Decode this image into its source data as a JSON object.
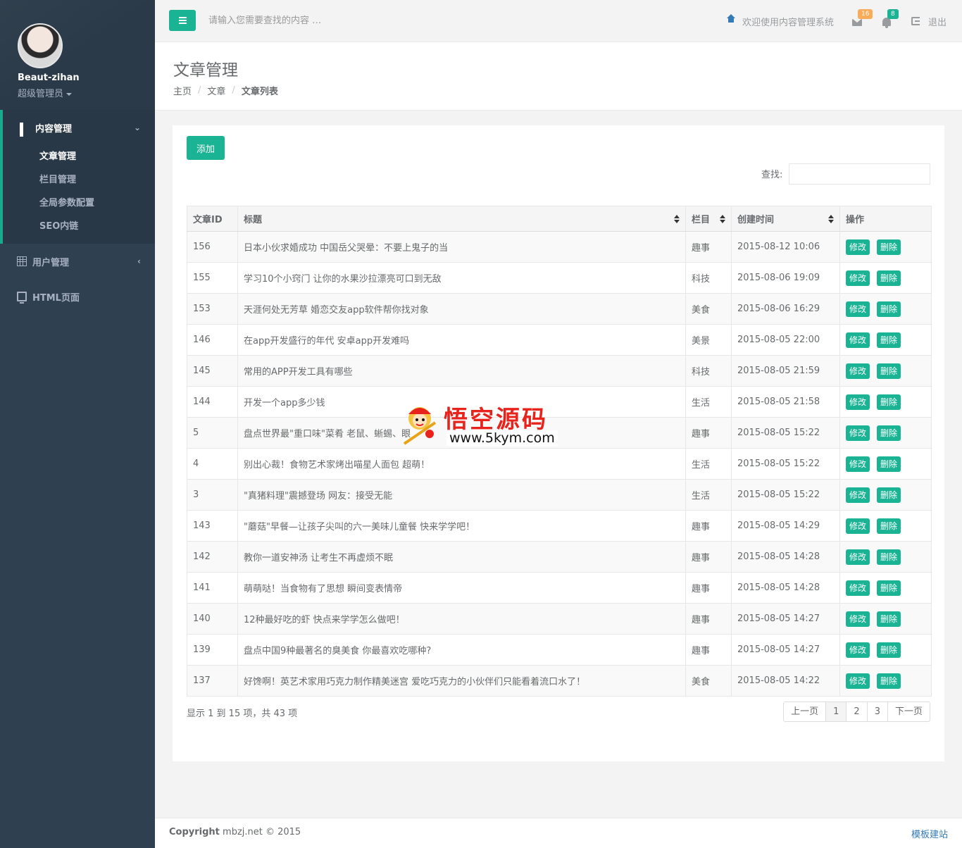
{
  "sidebar": {
    "profile": {
      "name": "Beaut-zihan",
      "role": "超级管理员"
    },
    "groups": [
      {
        "label": "内容管理",
        "items": [
          "文章管理",
          "栏目管理",
          "全局参数配置",
          "SEO内链"
        ]
      },
      {
        "label": "用户管理"
      },
      {
        "label": "HTML页面"
      }
    ]
  },
  "topbar": {
    "search_placeholder": "请输入您需要查找的内容 …",
    "welcome": "欢迎使用内容管理系统",
    "mail_count": "16",
    "alert_count": "8",
    "logout": "退出"
  },
  "page": {
    "title": "文章管理",
    "breadcrumb": [
      "主页",
      "文章",
      "文章列表"
    ]
  },
  "toolbar": {
    "add_label": "添加",
    "filter_label": "查找:"
  },
  "table": {
    "headers": [
      "文章ID",
      "标题",
      "栏目",
      "创建时间",
      "操作"
    ],
    "edit_label": "修改",
    "delete_label": "删除",
    "rows": [
      [
        "156",
        "日本小伙求婚成功 中国岳父哭晕：不要上鬼子的当",
        "趣事",
        "2015-08-12 10:06"
      ],
      [
        "155",
        "学习10个小窍门 让你的水果沙拉漂亮可口到无敌",
        "科技",
        "2015-08-06 19:09"
      ],
      [
        "153",
        "天涯何处无芳草 婚恋交友app软件帮你找对象",
        "美食",
        "2015-08-06 16:29"
      ],
      [
        "146",
        "在app开发盛行的年代 安卓app开发难吗",
        "美景",
        "2015-08-05 22:00"
      ],
      [
        "145",
        "常用的APP开发工具有哪些",
        "科技",
        "2015-08-05 21:59"
      ],
      [
        "144",
        "开发一个app多少钱",
        "生活",
        "2015-08-05 21:58"
      ],
      [
        "5",
        "盘点世界最\"重口味\"菜肴 老鼠、蜥蜴、眼",
        "趣事",
        "2015-08-05 15:22"
      ],
      [
        "4",
        "别出心裁！食物艺术家烤出喵星人面包 超萌！",
        "生活",
        "2015-08-05 15:22"
      ],
      [
        "3",
        "\"真猪料理\"震撼登场 网友：接受无能",
        "生活",
        "2015-08-05 15:22"
      ],
      [
        "143",
        "\"蘑菇\"早餐—让孩子尖叫的六一美味儿童餐 快来学学吧！",
        "趣事",
        "2015-08-05 14:29"
      ],
      [
        "142",
        "教你一道安神汤 让考生不再虚烦不眠",
        "趣事",
        "2015-08-05 14:28"
      ],
      [
        "141",
        "萌萌哒！当食物有了思想 瞬间变表情帝",
        "趣事",
        "2015-08-05 14:28"
      ],
      [
        "140",
        "12种最好吃的虾 快点来学学怎么做吧！",
        "趣事",
        "2015-08-05 14:27"
      ],
      [
        "139",
        "盘点中国9种最著名的臭美食 你最喜欢吃哪种?",
        "趣事",
        "2015-08-05 14:27"
      ],
      [
        "137",
        "好馋啊！英艺术家用巧克力制作精美迷宫 爱吃巧克力的小伙伴们只能看着流口水了！",
        "美食",
        "2015-08-05 14:22"
      ]
    ]
  },
  "pagination": {
    "info": "显示 1 到 15 项，共 43 项",
    "prev": "上一页",
    "pages": [
      "1",
      "2",
      "3"
    ],
    "next": "下一页"
  },
  "watermark": {
    "title": "悟空源码",
    "url": "www.5kym.com"
  },
  "footer": {
    "copyright_bold": "Copyright",
    "copyright_text": " mbzj.net © 2015",
    "link": "模板建站"
  },
  "colors": {
    "primary": "#1ab394",
    "sidebar": "#2f4050",
    "warning": "#f8ac59",
    "link": "#337ab7"
  }
}
